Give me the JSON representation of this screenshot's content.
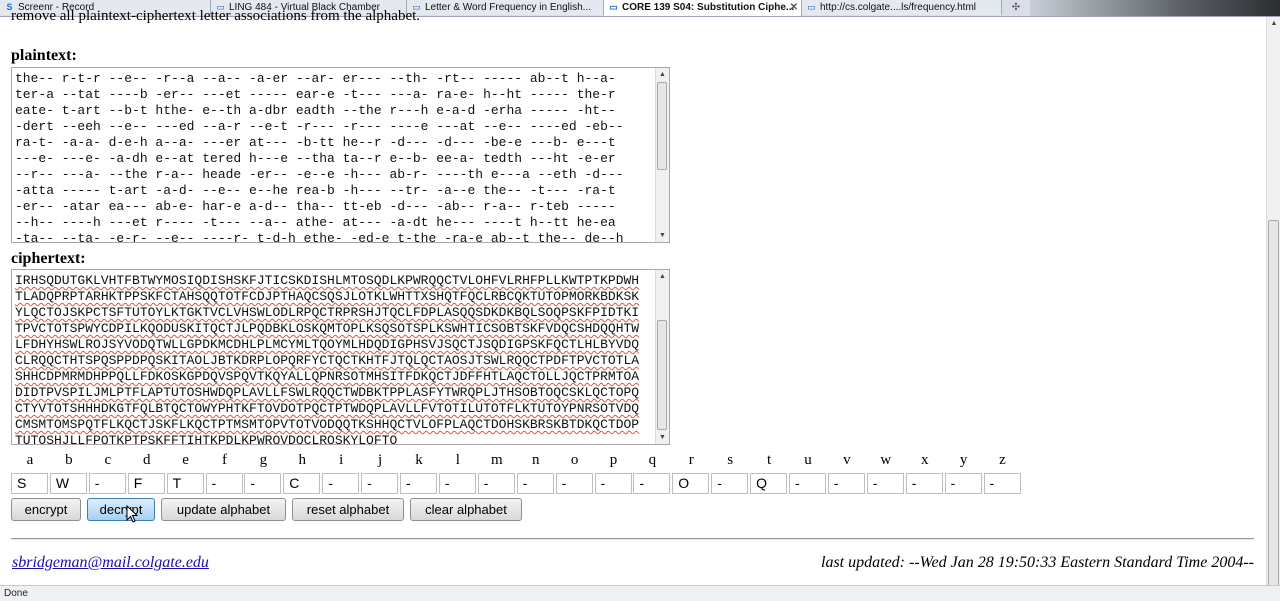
{
  "browser": {
    "tabs": [
      {
        "icon": "S",
        "label": "Screenr - Record",
        "active": false
      },
      {
        "icon": "▭",
        "label": "LING 484 - Virtual Black Chamber",
        "active": false
      },
      {
        "icon": "▭",
        "label": "Letter & Word Frequency in English...",
        "active": false
      },
      {
        "icon": "▭",
        "label": "CORE 139 S04: Substitution Ciphe...",
        "active": true
      },
      {
        "icon": "▭",
        "label": "http://cs.colgate....ls/frequency.html",
        "active": false
      }
    ],
    "new_tab_icon": "plus-icon",
    "status": "Done"
  },
  "page": {
    "top_cut_text": "remove all plaintext-ciphertext letter associations from the alphabet.",
    "plaintext_label": "plaintext:",
    "ciphertext_label": "ciphertext:",
    "plaintext_lines": [
      "the-- r-t-r --e-- -r--a --a-- -a-er --ar- er--- --th- -rt-- ----- ab--t h--a-",
      "ter-a --tat ----b -er-- ---et ----- ear-e -t--- ---a- ra-e- h--ht ----- the-r",
      "eate- t-art --b-t hthe- e--th a-dbr eadth --the r---h e-a-d -erha ----- -ht--",
      "-dert --eeh --e-- ---ed --a-r --e-t -r--- -r--- ----e ---at --e-- ----ed -eb--",
      "ra-t- -a-a- d-e-h a--a- ---er at--- -b-tt he--r -d--- -d--- -be-e ---b- e---t",
      "---e- ---e- -a-dh e--at tered h---e --tha ta--r e--b- ee-a- tedth ---ht -e-er",
      "--r-- ---a- --the r-a-- heade -er-- -e--e -h--- ab-r- ----th e---a --eth -d---",
      "-atta ----- t-art -a-d- --e-- e--he rea-b -h--- --tr- -a--e the-- -t--- -ra-t",
      "-er-- -atar ea--- ab-e- har-e a-d-- tha-- tt-eb -d--- -ab-- r-a-- r-teb -----",
      "--h-- ----h ---et r---- -t--- --a-- athe- at--- -a-dt he--- ----t h--tt he-ea",
      "-ta-- --ta- -e-r- --e-- ----r- t-d-h ethe- -ed-e t-the -ra-e ab--t the-- de--h"
    ],
    "ciphertext_lines": [
      "IRHSQDUTGKLVHTFBTWYMOSIQDISHSKFJTICSKDISHLMTOSQDLKPWRQQCTVLOHFVLRHFPLLKWTPTKPDWH",
      "TLADQPRPTARHKTPPSKFCTAHSQQTOTFCDJPTHAQCSQSJLOTKLWHTTXSHQTFQCLRBCQKTUTOPMORKBDKSK",
      "YLQCTOJSKPCTSFTUTOYLKTGKTVCLVHSWLODLRPQCTRPRSHJTQCLFDPLASQQSDKDKBQLSOQPSKFPIDTKI",
      "TPVCTOTSPWYCDPILKQODUSKITQCTJLPQDBKLOSKQMTOPLKSQSOTSPLKSWHTICSOBTSKFVDQCSHDQQHTW",
      "LFDHYHSWLROJSYVODQTWLLGPDKMCDHLPLMCYMLTQOYMLHDQDIGPHSVJSQCTJSQDIGPSKFQCTLHLBYVDQ",
      "CLRQQCTHTSPQSPPDPQSKITAOLJBTKDRPLOPQRFYCTQCTKHTFJTQLQCTAOSJTSWLRQQCTPDFTPVCTOTLA",
      "SHHCDPMRMDHPPQLLFDKOSKGPDQVSPQVTKQYALLQPNRSOTMHSITFDKQCTJDFFHTLAQCTOLLJQCTPRMTOA",
      "DIDTPVSPILJMLPTFLAPTUTOSHWDQPLAVLLFSWLRQQCTWDBKTPPLASFYTWRQPLJTHSOBTOQCSKLQCTOPQ",
      "CTYVTOTSHHHDKGTFQLBTQCTOWYPHTKFTOVDOTPQCTPTWDQPLAVLLFVTOTILUTOTFLKTUTOYPNRSOTVDQ",
      "CMSMTOMSPQTFLKQCTJSKFLKQCTPTMSMTOPVTOTVODQQTKSHHQCTVLOFPLAQCTDOHSKBRSKBTDKQCTDOP",
      "TUTOSHJLLFPQTKPTPSKFFTIHTKPDLKPWRQVDQCLRQSKYLOFTO"
    ],
    "alphabet_letters": [
      "a",
      "b",
      "c",
      "d",
      "e",
      "f",
      "g",
      "h",
      "i",
      "j",
      "k",
      "l",
      "m",
      "n",
      "o",
      "p",
      "q",
      "r",
      "s",
      "t",
      "u",
      "v",
      "w",
      "x",
      "y",
      "z"
    ],
    "alphabet_values": [
      "S",
      "W",
      "-",
      "F",
      "T",
      "-",
      "-",
      "C",
      "-",
      "-",
      "-",
      "-",
      "-",
      "-",
      "-",
      "-",
      "-",
      "O",
      "-",
      "Q",
      "-",
      "-",
      "-",
      "-",
      "-",
      "-"
    ],
    "buttons": {
      "encrypt": "encrypt",
      "decrypt": "decrypt",
      "update": "update alphabet",
      "reset": "reset alphabet",
      "clear": "clear alphabet"
    },
    "footer": {
      "email": "sbridgeman@mail.colgate.edu",
      "updated": "last updated: --Wed Jan 28 19:50:33 Eastern Standard Time 2004--"
    }
  }
}
